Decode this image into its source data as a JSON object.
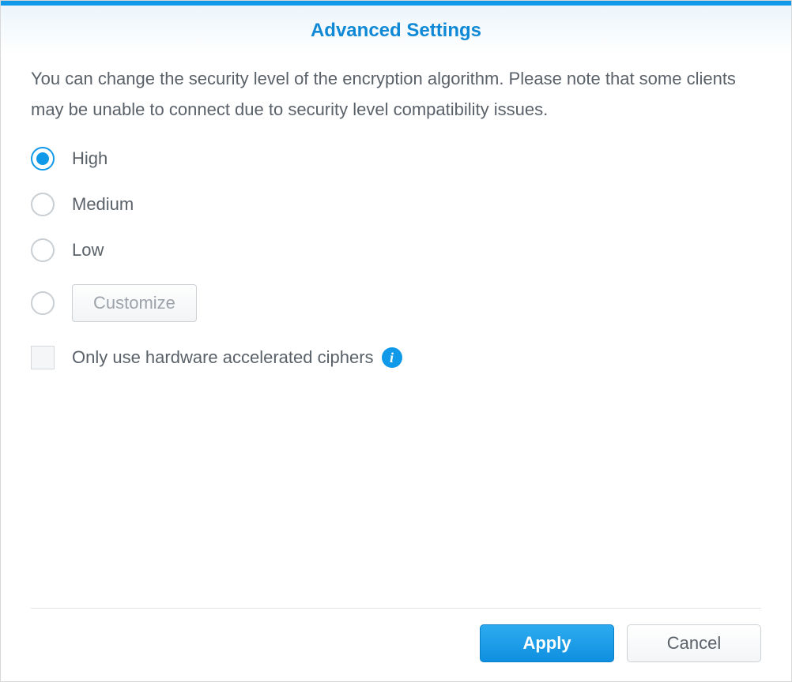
{
  "header": {
    "title": "Advanced Settings"
  },
  "description": "You can change the security level of the encryption algorithm. Please note that some clients may be unable to connect due to security level compatibility issues.",
  "options": {
    "high": "High",
    "medium": "Medium",
    "low": "Low",
    "customize_button": "Customize",
    "selected": "high"
  },
  "checkbox": {
    "label": "Only use hardware accelerated ciphers",
    "checked": false
  },
  "footer": {
    "apply": "Apply",
    "cancel": "Cancel"
  }
}
